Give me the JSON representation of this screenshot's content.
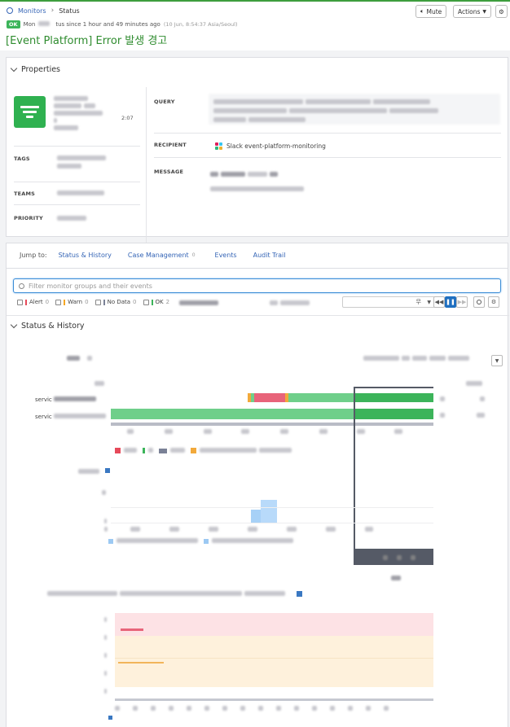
{
  "breadcrumb": {
    "root": "Monitors",
    "current": "Status"
  },
  "status": {
    "badge": "OK",
    "text_prefix": "Mon",
    "text_suffix": "tus since 1 hour and 49 minutes ago",
    "timestamp": "(10 Jun, 8:54:37 Asia/Seoul)"
  },
  "title": "[Event Platform] Error 발생 경고",
  "header_actions": {
    "mute": "Mute",
    "actions": "Actions"
  },
  "properties": {
    "heading": "Properties",
    "created_time": "2:07",
    "labels": {
      "tags": "TAGS",
      "teams": "TEAMS",
      "priority": "PRIORITY",
      "query": "QUERY",
      "recipient": "RECIPIENT",
      "message": "MESSAGE"
    },
    "recipient": "Slack event-platform-monitoring"
  },
  "jump": {
    "label": "Jump to:",
    "links": [
      "Status & History",
      "Case Management",
      "Events",
      "Audit Trail"
    ],
    "case_count": "0"
  },
  "filter": {
    "placeholder": "Filter monitor groups and their events",
    "checkboxes": [
      {
        "label": "Alert",
        "count": "0",
        "color": "#e64a5a"
      },
      {
        "label": "Warn",
        "count": "0",
        "color": "#f5a623"
      },
      {
        "label": "No Data",
        "count": "0",
        "color": "#7a8196"
      },
      {
        "label": "OK",
        "count": "2",
        "color": "#3cb45a"
      }
    ],
    "timeframe_suffix": "무"
  },
  "status_history": {
    "heading": "Status & History",
    "series_prefix": "servic",
    "colors": {
      "ok": "#3cb45a",
      "ok_light": "#6fcf8a",
      "alert": "#e8647a",
      "warn": "#f2a93b",
      "nodata": "#7a8196"
    }
  }
}
